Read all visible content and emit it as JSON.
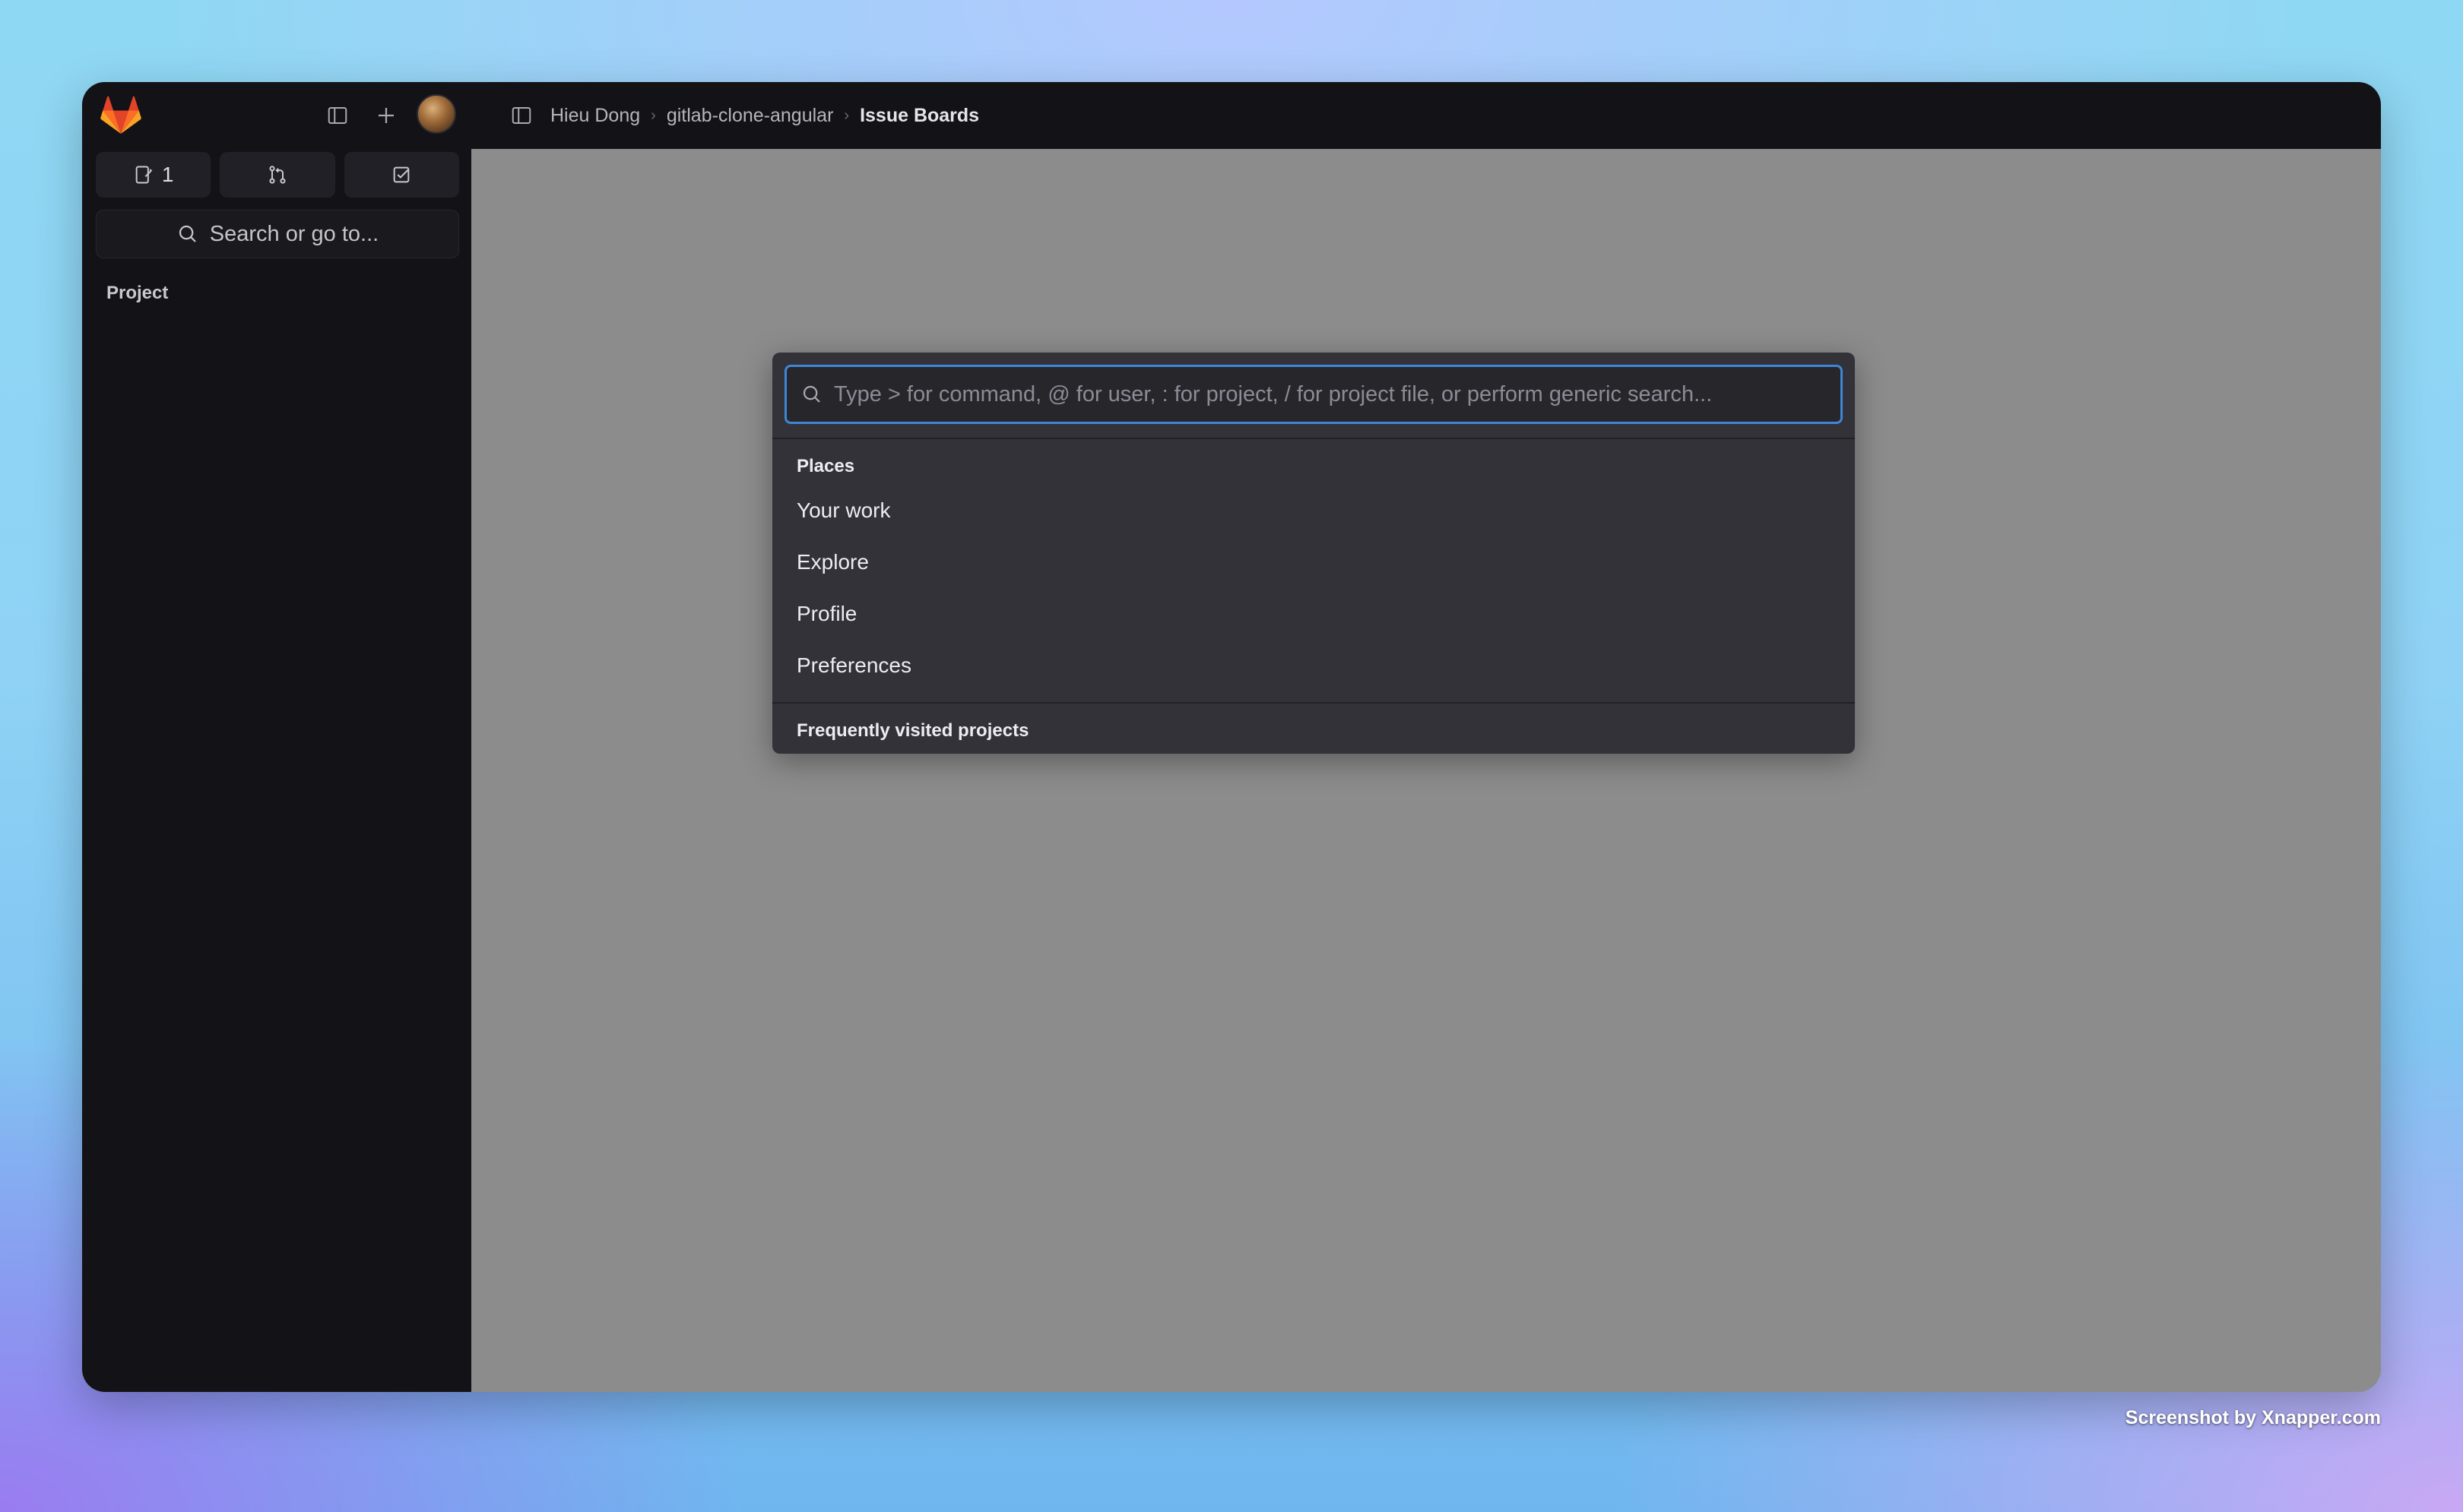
{
  "sidebar": {
    "counters": [
      {
        "icon": "issues-icon",
        "count": "1"
      },
      {
        "icon": "merge-request-icon",
        "count": ""
      },
      {
        "icon": "todo-icon",
        "count": ""
      }
    ],
    "search_label": "Search or go to...",
    "section_title": "Project"
  },
  "topbar": {
    "breadcrumbs": [
      "Hieu Dong",
      "gitlab-clone-angular",
      "Issue Boards"
    ]
  },
  "palette": {
    "placeholder": "Type > for command, @ for user, : for project, / for project file, or perform generic search...",
    "value": "",
    "groups": [
      {
        "title": "Places",
        "items": [
          "Your work",
          "Explore",
          "Profile",
          "Preferences"
        ]
      },
      {
        "title": "Frequently visited projects",
        "items": []
      }
    ]
  },
  "colors": {
    "focus_ring": "#3f86d8",
    "sidebar_bg": "#131317",
    "overlay_bg": "#8c8c8c",
    "palette_bg": "#333238",
    "logo_orange": "#e24329"
  },
  "watermark": "Screenshot by Xnapper.com"
}
